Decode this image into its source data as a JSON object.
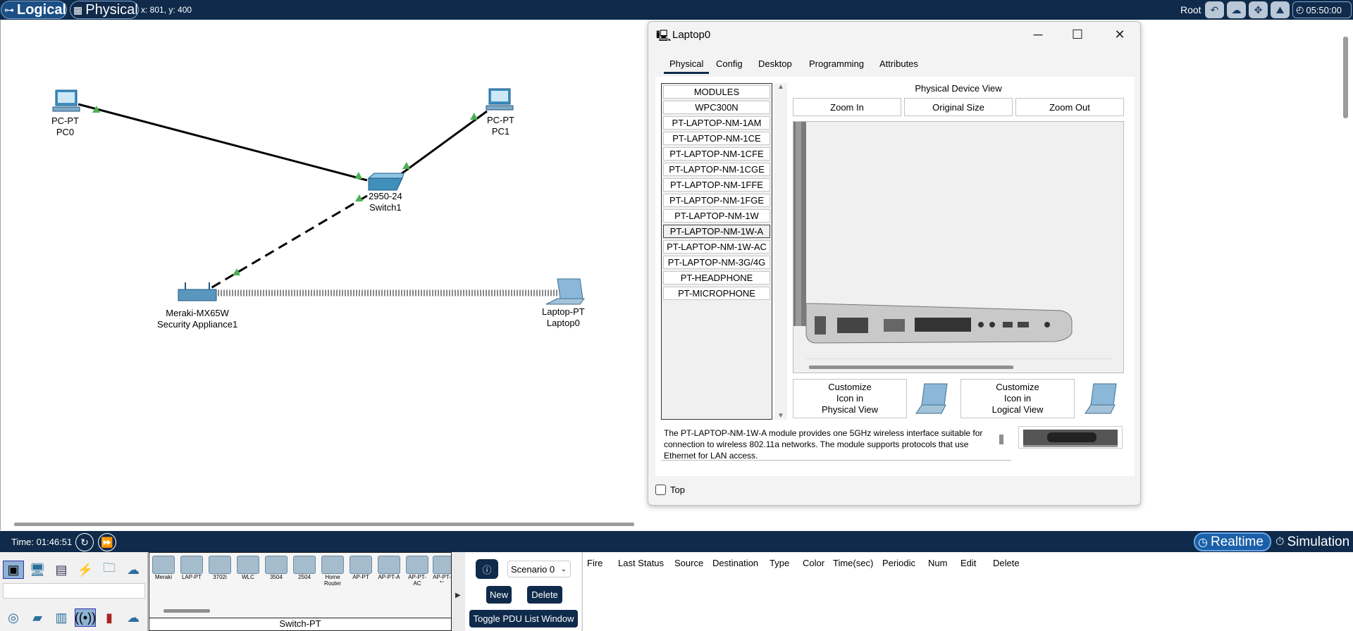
{
  "topbar": {
    "logical_label": "Logical",
    "physical_label": "Physical",
    "coords": "x: 801, y: 400",
    "root_label": "Root",
    "clock": "05:50:00"
  },
  "workspace": {
    "devices": [
      {
        "model": "PC-PT",
        "name": "PC0"
      },
      {
        "model": "PC-PT",
        "name": "PC1"
      },
      {
        "model": "2950-24",
        "name": "Switch1"
      },
      {
        "model": "Meraki-MX65W",
        "name": "Security Appliance1"
      },
      {
        "model": "Laptop-PT",
        "name": "Laptop0"
      }
    ]
  },
  "dialog": {
    "title": "Laptop0",
    "tabs": [
      "Physical",
      "Config",
      "Desktop",
      "Programming",
      "Attributes"
    ],
    "view_title": "Physical Device View",
    "zoom_in": "Zoom In",
    "original_size": "Original Size",
    "zoom_out": "Zoom Out",
    "modules": [
      "MODULES",
      "WPC300N",
      "PT-LAPTOP-NM-1AM",
      "PT-LAPTOP-NM-1CE",
      "PT-LAPTOP-NM-1CFE",
      "PT-LAPTOP-NM-1CGE",
      "PT-LAPTOP-NM-1FFE",
      "PT-LAPTOP-NM-1FGE",
      "PT-LAPTOP-NM-1W",
      "PT-LAPTOP-NM-1W-A",
      "PT-LAPTOP-NM-1W-AC",
      "PT-LAPTOP-NM-3G/4G",
      "PT-HEADPHONE",
      "PT-MICROPHONE"
    ],
    "selected_module": "PT-LAPTOP-NM-1W-A",
    "custom_physical": [
      "Customize",
      "Icon in",
      "Physical View"
    ],
    "custom_logical": [
      "Customize",
      "Icon in",
      "Logical View"
    ],
    "description": "The PT-LAPTOP-NM-1W-A module provides one 5GHz wireless interface suitable for connection to wireless 802.11a networks. The module supports protocols that use Ethernet for LAN access.",
    "top_label": "Top"
  },
  "statusbar": {
    "time": "Time: 01:46:51",
    "realtime": "Realtime",
    "simulation": "Simulation"
  },
  "bottom": {
    "device_tiles": [
      "Meraki",
      "LAP-PT",
      "3702i",
      "WLC",
      "3504",
      "2504",
      "Home Router",
      "AP-PT",
      "AP-PT-A",
      "AP-PT-AC",
      "AP-PT-N"
    ],
    "category_label": "Switch-PT",
    "scenario": "Scenario 0",
    "new_label": "New",
    "delete_label": "Delete",
    "toggle_label": "Toggle PDU List Window",
    "pdu_headers": [
      "Fire",
      "Last Status",
      "Source",
      "Destination",
      "Type",
      "Color",
      "Time(sec)",
      "Periodic",
      "Num",
      "Edit",
      "Delete"
    ]
  }
}
